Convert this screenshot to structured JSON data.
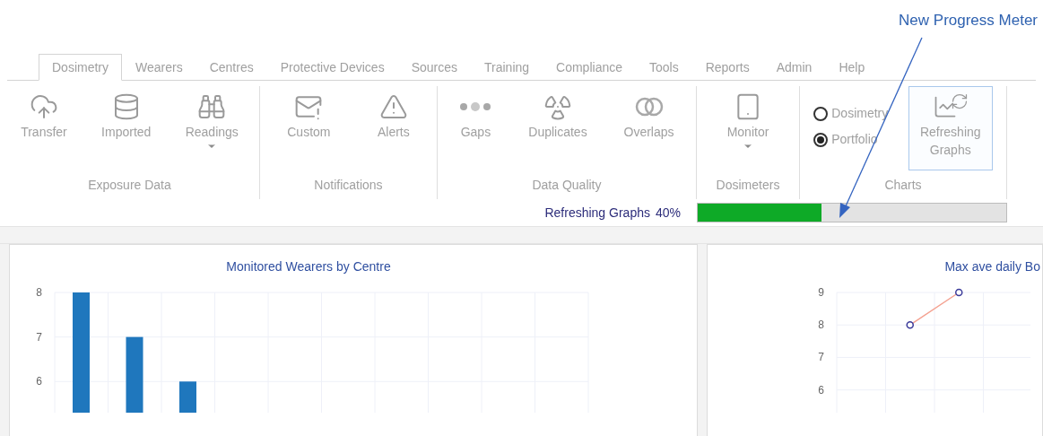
{
  "annotation": {
    "text": "New Progress Meter"
  },
  "tabs": [
    {
      "label": "Dosimetry",
      "selected": true
    },
    {
      "label": "Wearers",
      "selected": false
    },
    {
      "label": "Centres",
      "selected": false
    },
    {
      "label": "Protective Devices",
      "selected": false
    },
    {
      "label": "Sources",
      "selected": false
    },
    {
      "label": "Training",
      "selected": false
    },
    {
      "label": "Compliance",
      "selected": false
    },
    {
      "label": "Tools",
      "selected": false
    },
    {
      "label": "Reports",
      "selected": false
    },
    {
      "label": "Admin",
      "selected": false
    },
    {
      "label": "Help",
      "selected": false
    }
  ],
  "ribbon": {
    "groups": [
      {
        "label": "Exposure Data",
        "items": [
          {
            "kind": "button",
            "label": "Transfer",
            "dropdown": false
          },
          {
            "kind": "button",
            "label": "Imported",
            "dropdown": false
          },
          {
            "kind": "button",
            "label": "Readings",
            "dropdown": true
          }
        ]
      },
      {
        "label": "Notifications",
        "items": [
          {
            "kind": "button",
            "label": "Custom",
            "dropdown": false
          },
          {
            "kind": "button",
            "label": "Alerts",
            "dropdown": false
          }
        ]
      },
      {
        "label": "Data Quality",
        "items": [
          {
            "kind": "button",
            "label": "Gaps",
            "dropdown": false
          },
          {
            "kind": "button",
            "label": "Duplicates",
            "dropdown": false
          },
          {
            "kind": "button",
            "label": "Overlaps",
            "dropdown": false
          }
        ]
      },
      {
        "label": "Dosimeters",
        "items": [
          {
            "kind": "button",
            "label": "Monitor",
            "dropdown": true
          }
        ]
      },
      {
        "label": "Charts",
        "items": [
          {
            "kind": "radios",
            "options": [
              {
                "label": "Dosimetry",
                "selected": false
              },
              {
                "label": "Portfolio",
                "selected": true
              }
            ]
          },
          {
            "kind": "button",
            "label": "Refreshing Graphs",
            "dropdown": false,
            "selected": true
          }
        ]
      }
    ]
  },
  "progress": {
    "label": "Refreshing Graphs",
    "reading": "40%",
    "level": 0.4
  },
  "panels": [
    {
      "title": "Monitored Wearers by Centre",
      "chart_data": {
        "type": "bar",
        "values": [
          8,
          7,
          6,
          null,
          null,
          null,
          null,
          null,
          null,
          null
        ],
        "ylim": [
          5.3,
          8
        ],
        "yticks": [
          6,
          7,
          8
        ],
        "grid": true
      }
    },
    {
      "title": "Max ave daily Bo",
      "chart_data": {
        "type": "line",
        "series": [
          {
            "color": "#f4a08f",
            "marker": "o",
            "values": [
              null,
              8,
              9,
              null
            ]
          }
        ],
        "ylim": [
          5.3,
          9
        ],
        "yticks": [
          6,
          7,
          8,
          9
        ],
        "grid": true
      }
    }
  ]
}
